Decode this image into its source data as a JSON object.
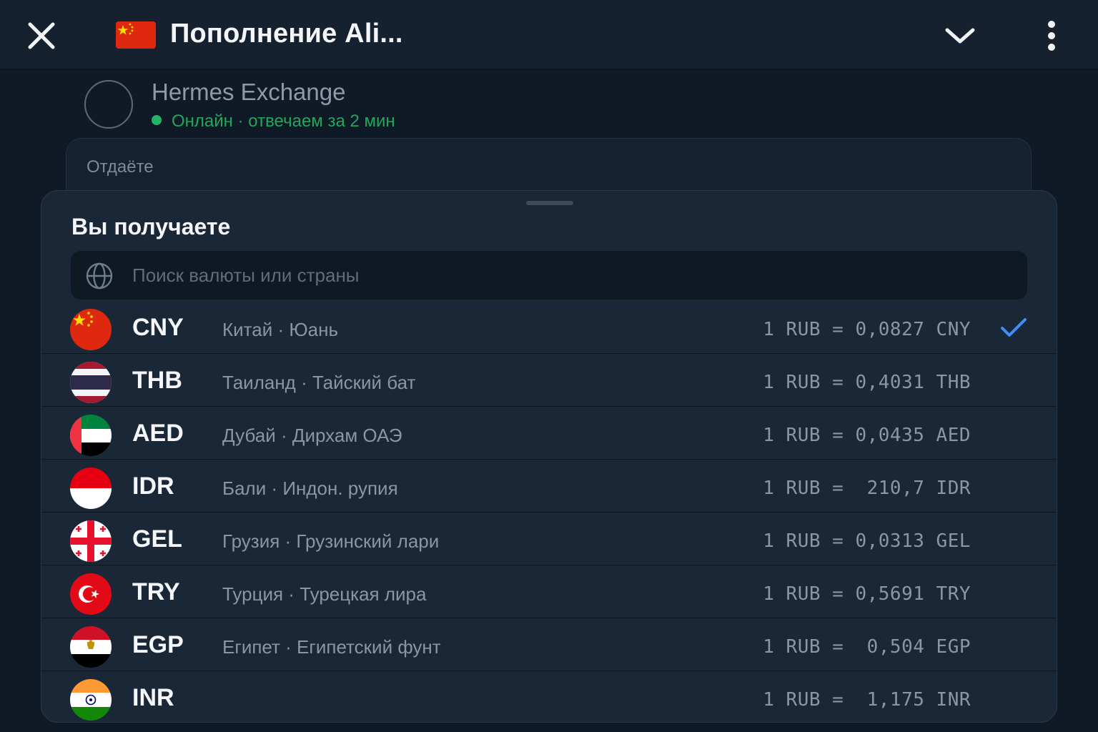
{
  "header": {
    "title": "Пополнение Ali...",
    "flag_icon": "china-flag-icon",
    "close_icon": "close-icon",
    "chevron_icon": "chevron-down-icon",
    "menu_icon": "kebab-menu-icon"
  },
  "contact": {
    "name": "Hermes Exchange",
    "status": "Онлайн · отвечаем за 2 мин",
    "status_color": "#23a65c"
  },
  "give_card": {
    "label": "Отдаёте"
  },
  "sheet": {
    "title": "Вы получаете",
    "search": {
      "placeholder": "Поиск валюты или страны",
      "value": "",
      "icon": "globe-icon"
    },
    "currencies": [
      {
        "code": "CNY",
        "desc": "Китай · Юань",
        "rate": "1 RUB = 0,0827 CNY",
        "selected": true
      },
      {
        "code": "THB",
        "desc": "Таиланд · Тайский бат",
        "rate": "1 RUB = 0,4031 THB",
        "selected": false
      },
      {
        "code": "AED",
        "desc": "Дубай · Дирхам ОАЭ",
        "rate": "1 RUB = 0,0435 AED",
        "selected": false
      },
      {
        "code": "IDR",
        "desc": "Бали · Индон. рупия",
        "rate": "1 RUB =  210,7 IDR",
        "selected": false
      },
      {
        "code": "GEL",
        "desc": "Грузия · Грузинский лари",
        "rate": "1 RUB = 0,0313 GEL",
        "selected": false
      },
      {
        "code": "TRY",
        "desc": "Турция · Турецкая лира",
        "rate": "1 RUB = 0,5691 TRY",
        "selected": false
      },
      {
        "code": "EGP",
        "desc": "Египет · Египетский фунт",
        "rate": "1 RUB =  0,504 EGP",
        "selected": false
      },
      {
        "code": "INR",
        "desc": "",
        "rate": "1 RUB =  1,175 INR",
        "selected": false
      }
    ]
  },
  "colors": {
    "background": "#0f1a26",
    "accent_check": "#3d8ef7",
    "online_dot": "#23b565"
  }
}
